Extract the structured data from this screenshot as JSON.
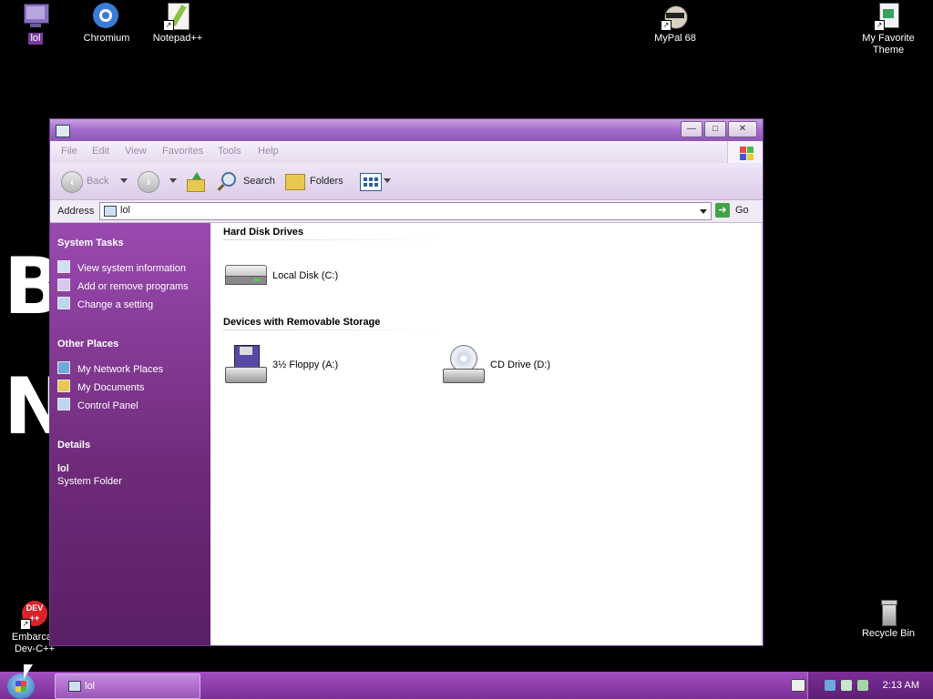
{
  "desktop": {
    "wallpaper_letters": [
      "B",
      "N"
    ],
    "icons": [
      {
        "label": "lol",
        "icon": "computer-icon",
        "selected": true
      },
      {
        "label": "Chromium",
        "icon": "chromium-icon"
      },
      {
        "label": "Notepad++",
        "icon": "notepad-plus-plus-icon"
      },
      {
        "label": "MyPal 68",
        "icon": "mypal-icon"
      },
      {
        "label": "My Favorite Theme",
        "icon": "theme-file-icon"
      },
      {
        "label": "Embarcadero Dev-C++",
        "label_visible": "Embarcad Dev-C++",
        "icon": "devcpp-icon"
      },
      {
        "label": "Recycle Bin",
        "icon": "recycle-bin-icon"
      }
    ]
  },
  "window": {
    "title": "",
    "buttons": {
      "minimize": "—",
      "maximize": "□",
      "close": "✕"
    },
    "menu": [
      "File",
      "Edit",
      "View",
      "Favorites",
      "Tools",
      "Help"
    ],
    "toolbar": {
      "back": "Back",
      "search": "Search",
      "folders": "Folders"
    },
    "address": {
      "label": "Address",
      "value": "lol",
      "go": "Go"
    },
    "side_panel": {
      "system_tasks": {
        "title": "System Tasks",
        "items": [
          "View system information",
          "Add or remove programs",
          "Change a setting"
        ]
      },
      "other_places": {
        "title": "Other Places",
        "items": [
          "My Network Places",
          "My Documents",
          "Control Panel"
        ]
      },
      "details": {
        "title": "Details",
        "name": "lol",
        "type": "System Folder"
      }
    },
    "content": {
      "groups": [
        {
          "title": "Hard Disk Drives",
          "items": [
            {
              "label": "Local Disk (C:)",
              "icon": "hard-disk-icon"
            }
          ]
        },
        {
          "title": "Devices with Removable Storage",
          "items": [
            {
              "label": "3½ Floppy (A:)",
              "icon": "floppy-drive-icon"
            },
            {
              "label": "CD Drive (D:)",
              "icon": "cd-drive-icon"
            }
          ]
        }
      ]
    }
  },
  "taskbar": {
    "task_label": "lol",
    "clock": "2:13 AM"
  },
  "colors": {
    "accent": "#8d56b8",
    "side_panel": "#6d2a78",
    "taskbar": "#7a2e96"
  }
}
